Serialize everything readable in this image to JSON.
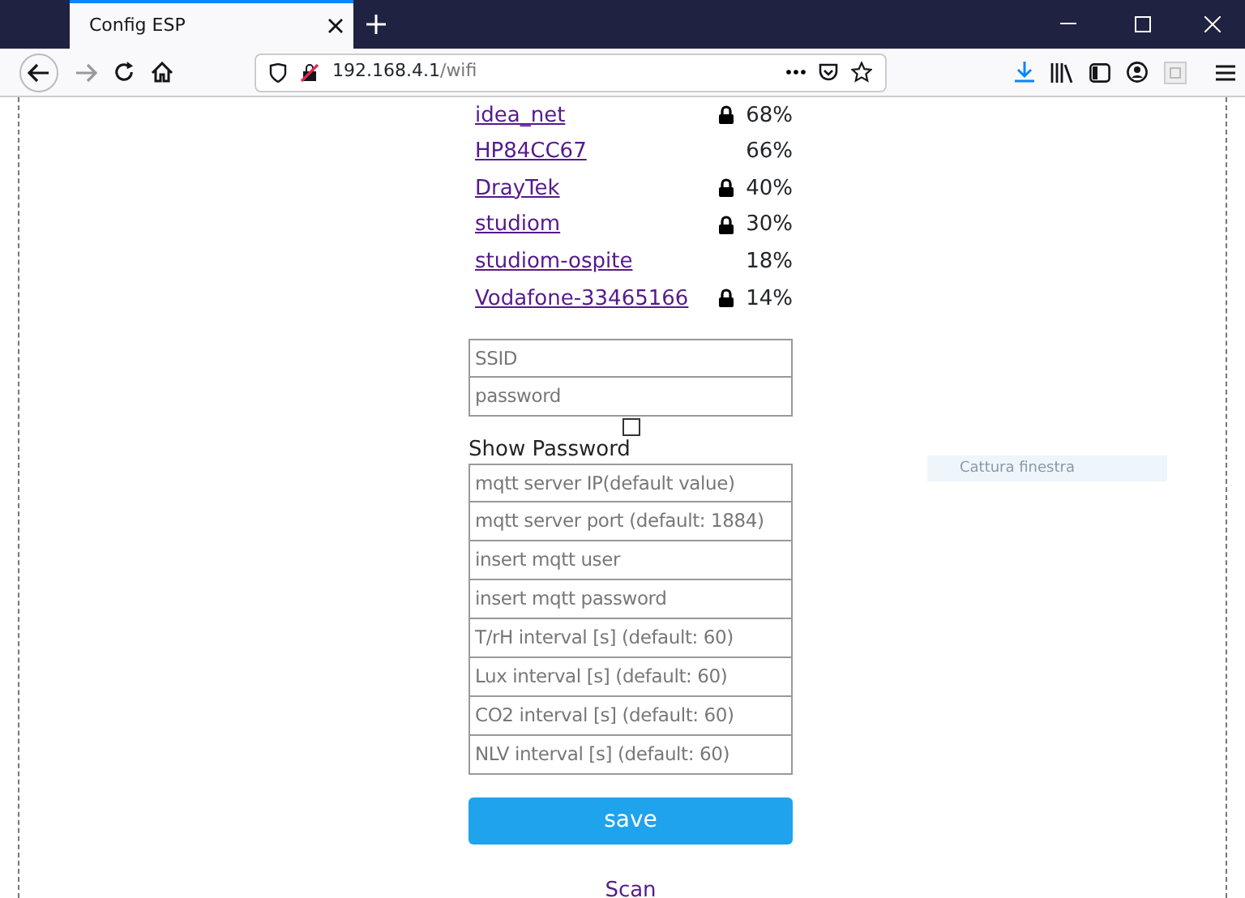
{
  "browser": {
    "tab_title": "Config ESP",
    "url_host": "192.168.4.1",
    "url_path": "/wifi"
  },
  "networks": [
    {
      "name": "idea_net",
      "locked": true,
      "signal": "68%"
    },
    {
      "name": "HP84CC67",
      "locked": false,
      "signal": "66%"
    },
    {
      "name": "DrayTek",
      "locked": true,
      "signal": "40%"
    },
    {
      "name": "studiom",
      "locked": true,
      "signal": "30%"
    },
    {
      "name": "studiom-ospite",
      "locked": false,
      "signal": "18%"
    },
    {
      "name": "Vodafone-33465166",
      "locked": true,
      "signal": "14%"
    }
  ],
  "wifi_fields": [
    {
      "placeholder": "SSID"
    },
    {
      "placeholder": "password"
    }
  ],
  "show_password": {
    "label": "Show Password",
    "checked": false
  },
  "mqtt_fields": [
    {
      "placeholder": "mqtt server IP(default value)"
    },
    {
      "placeholder": "mqtt server port (default: 1884)"
    },
    {
      "placeholder": "insert mqtt user"
    },
    {
      "placeholder": "insert mqtt password"
    },
    {
      "placeholder": "T/rH interval [s] (default: 60)"
    },
    {
      "placeholder": "Lux interval [s] (default: 60)"
    },
    {
      "placeholder": "CO2 interval [s] (default: 60)"
    },
    {
      "placeholder": "NLV interval [s] (default: 60)"
    }
  ],
  "save_button": "save",
  "scan_link": "Scan",
  "capture_tooltip": "Cattura finestra"
}
